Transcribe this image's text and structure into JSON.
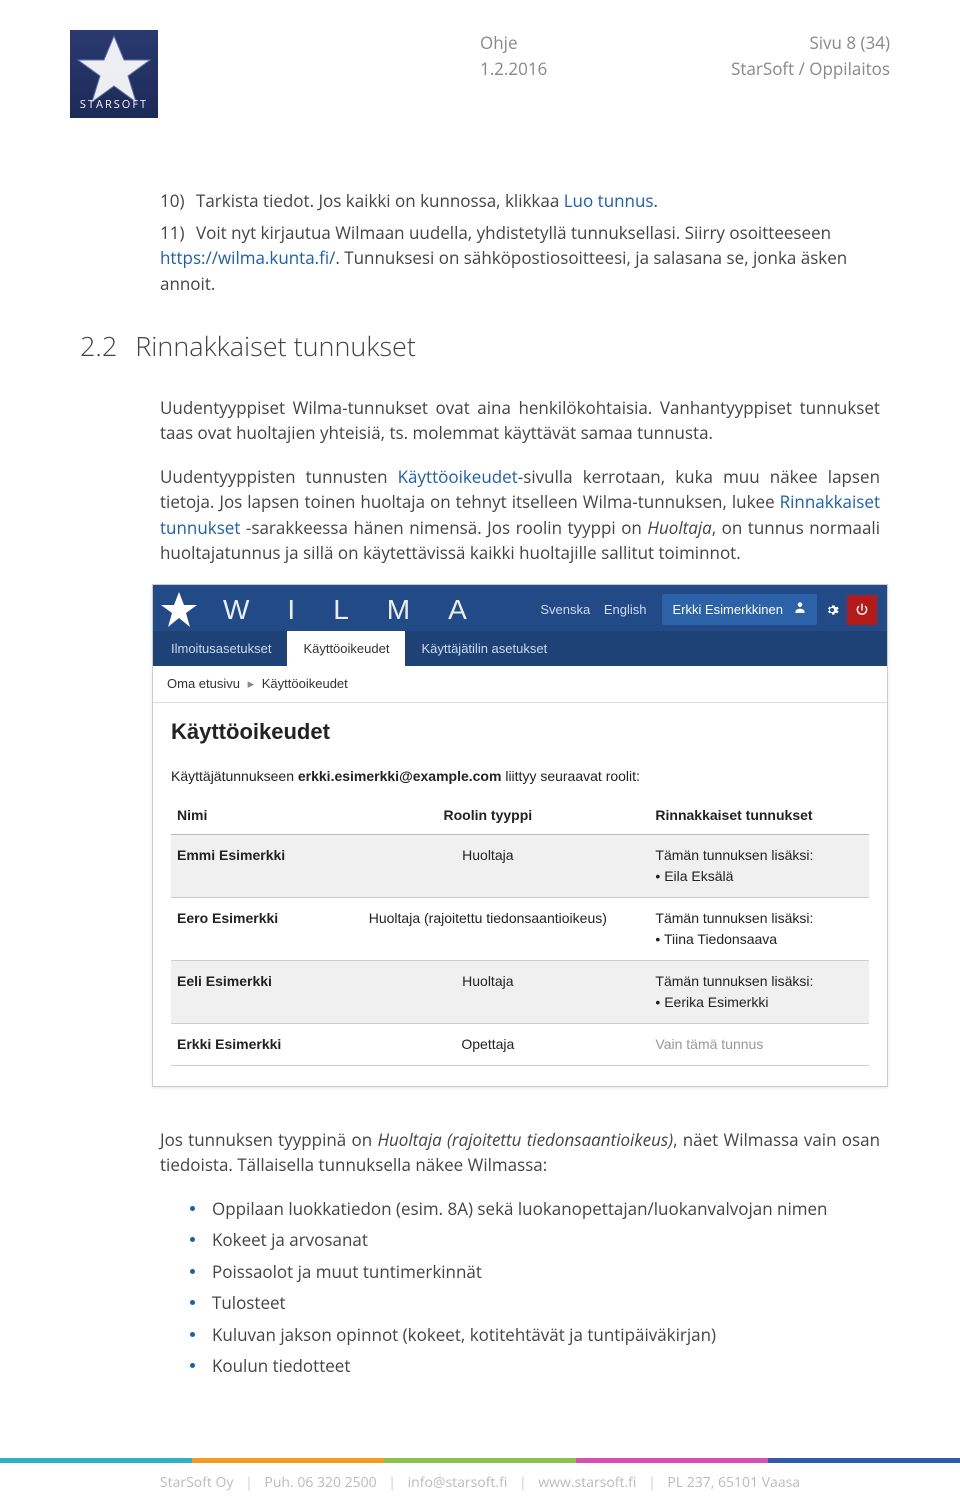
{
  "header": {
    "logo_text": "STARSOFT",
    "col1_line1": "Ohje",
    "col1_line2": "1.2.2016",
    "col2_line1": "Sivu 8 (34)",
    "col2_line2": "StarSoft / Oppilaitos"
  },
  "list": {
    "item10_num": "10)",
    "item10_text_a": "Tarkista tiedot. Jos kaikki on kunnossa, klikkaa ",
    "item10_link": "Luo tunnus",
    "item10_text_b": ".",
    "item11_num": "11)",
    "item11_text_a": "Voit nyt kirjautua Wilmaan uudella, yhdistetyllä tunnuksellasi. Siirry osoitteeseen ",
    "item11_link": "https://wilma.kunta.fi/",
    "item11_text_b": ". Tunnuksesi on sähköpostiosoitteesi, ja salasana se, jonka äsken annoit."
  },
  "section": {
    "num": "2.2",
    "title": "Rinnakkaiset tunnukset"
  },
  "para1": "Uudentyyppiset Wilma-tunnukset ovat aina henkilökohtaisia. Vanhantyyppiset tunnukset taas ovat huoltajien yhteisiä, ts. molemmat käyttävät samaa tunnusta.",
  "para2_a": "Uudentyyppisten tunnusten ",
  "para2_link1": "Käyttöoikeudet",
  "para2_b": "-sivulla kerrotaan, kuka muu näkee lapsen tietoja. Jos lapsen toinen huoltaja on tehnyt itselleen Wilma-tunnuksen, lukee ",
  "para2_link2": "Rinnakkaiset tunnukset",
  "para2_c": " -sarakkeessa hänen nimensä. Jos roolin tyyppi on ",
  "para2_em": "Huoltaja",
  "para2_d": ", on tunnus normaali huoltajatunnus ja sillä on käytettävissä kaikki huoltajille sallitut toiminnot.",
  "wilma": {
    "letters": "WILMA",
    "lang1": "Svenska",
    "lang2": "English",
    "user": "Erkki Esimerkkinen",
    "tabs": [
      "Ilmoitusasetukset",
      "Käyttöoikeudet",
      "Käyttäjätilin asetukset"
    ],
    "active_tab_index": 1,
    "crumb_home": "Oma etusivu",
    "crumb_sep": "▸",
    "crumb_current": "Käyttöoikeudet",
    "page_title": "Käyttöoikeudet",
    "intro_a": "Käyttäjätunnukseen ",
    "intro_email": "erkki.esimerkki@example.com",
    "intro_b": " liittyy seuraavat roolit:",
    "columns": [
      "Nimi",
      "Roolin tyyppi",
      "Rinnakkaiset tunnukset"
    ],
    "rows": [
      {
        "name": "Emmi Esimerkki",
        "type": "Huoltaja",
        "parallel_label": "Tämän tunnuksen lisäksi:",
        "parallel_name": "• Eila Eksälä"
      },
      {
        "name": "Eero Esimerkki",
        "type": "Huoltaja (rajoitettu tiedonsaantioikeus)",
        "parallel_label": "Tämän tunnuksen lisäksi:",
        "parallel_name": "• Tiina Tiedonsaava"
      },
      {
        "name": "Eeli Esimerkki",
        "type": "Huoltaja",
        "parallel_label": "Tämän tunnuksen lisäksi:",
        "parallel_name": "• Eerika Esimerkki"
      },
      {
        "name": "Erkki Esimerkki",
        "type": "Opettaja",
        "parallel_only": "Vain tämä tunnus"
      }
    ]
  },
  "para3_a": "Jos tunnuksen tyyppinä on ",
  "para3_em": "Huoltaja (rajoitettu tiedonsaantioikeus)",
  "para3_b": ", näet Wilmassa vain osan tiedoista. Tällaisella tunnuksella näkee Wilmassa:",
  "bullets": [
    "Oppilaan luokkatiedon (esim. 8A) sekä luokanopettajan/luokanvalvojan nimen",
    "Kokeet ja arvosanat",
    "Poissaolot ja muut tuntimerkinnät",
    "Tulosteet",
    "Kuluvan jakson opinnot (kokeet, kotitehtävät ja tuntipäiväkirjan)",
    "Koulun tiedotteet"
  ],
  "footer": {
    "company": "StarSoft Oy",
    "phone": "Puh. 06 320 2500",
    "email": "info@starsoft.fi",
    "web": "www.starsoft.fi",
    "address": "PL 237, 65101 Vaasa",
    "sep": "|"
  }
}
